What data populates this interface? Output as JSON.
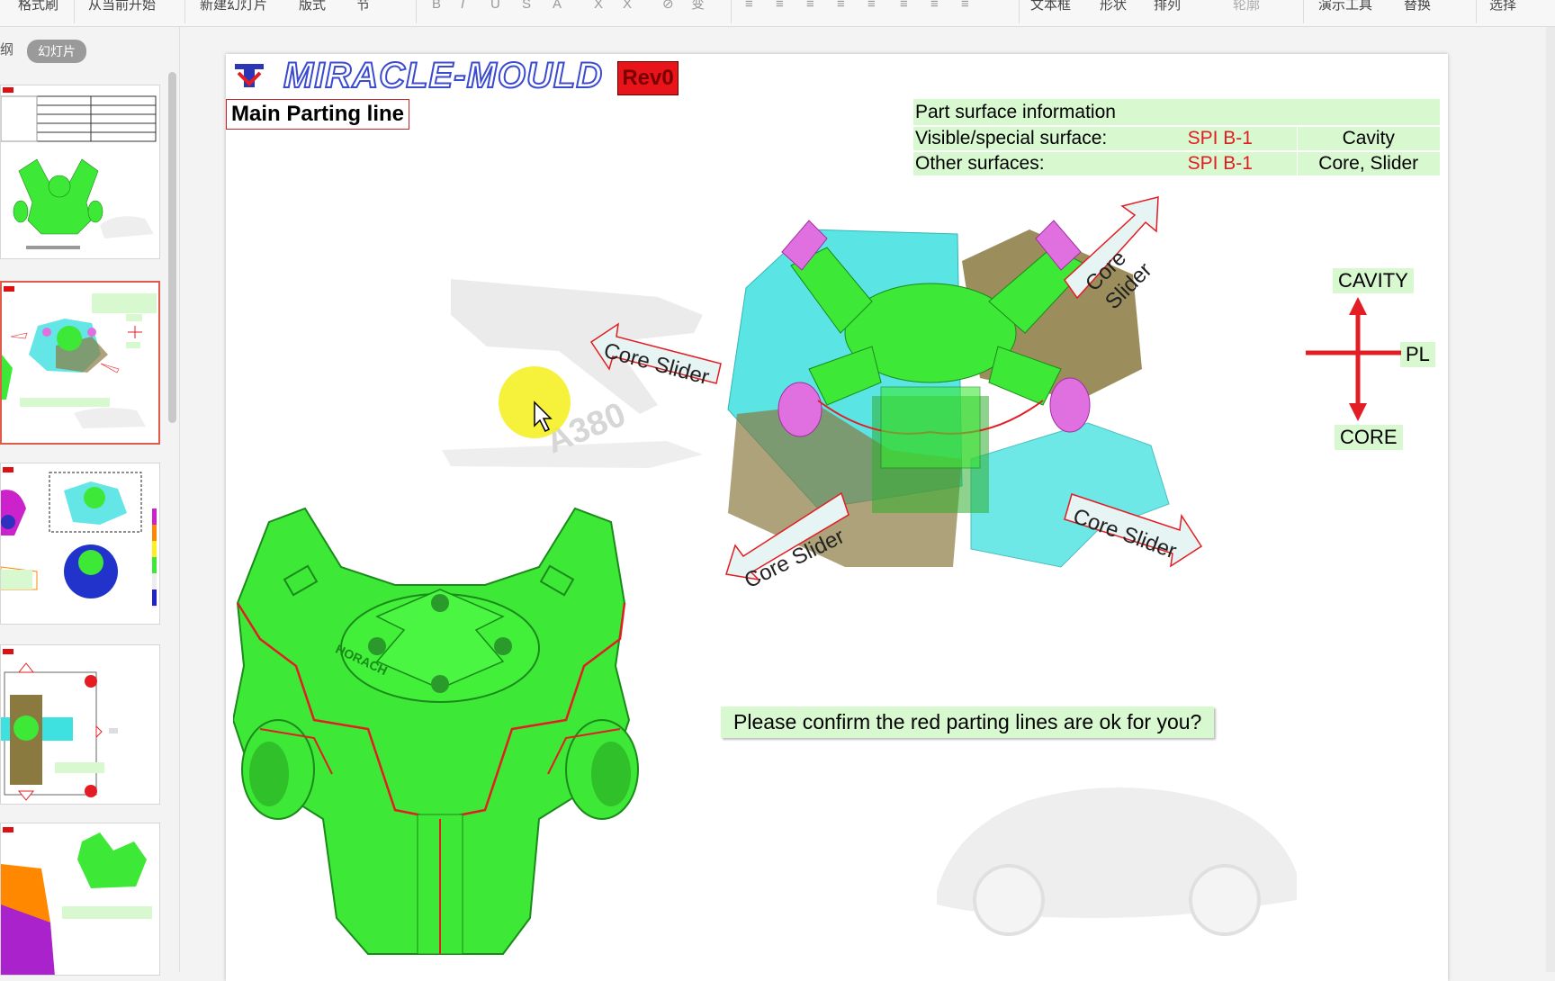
{
  "toolbar": {
    "items": [
      "格式刷",
      "从当前开始",
      "新建幻灯片",
      "版式",
      "节",
      "文本框",
      "形状",
      "排列",
      "轮廓",
      "演示工具",
      "替换",
      "选择"
    ]
  },
  "left_panel": {
    "tab_outline": "纲",
    "tab_slides": "幻灯片"
  },
  "slide": {
    "logo_text": "MIRACLE-MOULD",
    "rev": "Rev0",
    "title": "Main Parting line",
    "info": {
      "header": "Part surface information",
      "rows": [
        {
          "label": "Visible/special surface:",
          "spi": "SPI B-1",
          "value": "Cavity"
        },
        {
          "label": "Other surfaces:",
          "spi": "SPI B-1",
          "value": "Core, Slider"
        }
      ]
    },
    "axis": {
      "cavity": "CAVITY",
      "pl": "PL",
      "core": "CORE"
    },
    "sliders": {
      "label": "Core Slider",
      "label_2line_a": "Core",
      "label_2line_b": "Slider"
    },
    "confirm": "Please confirm the red parting lines are ok for you?",
    "watermark_text": "A380",
    "part_mark": "HORACH"
  },
  "colors": {
    "part_green": "#3ee836",
    "cavity_cyan": "#3ee0e0",
    "core_olive": "#8a7a40",
    "accent_red": "#e21d23",
    "label_bg": "#d8f8d0",
    "pink": "#e070e0"
  }
}
